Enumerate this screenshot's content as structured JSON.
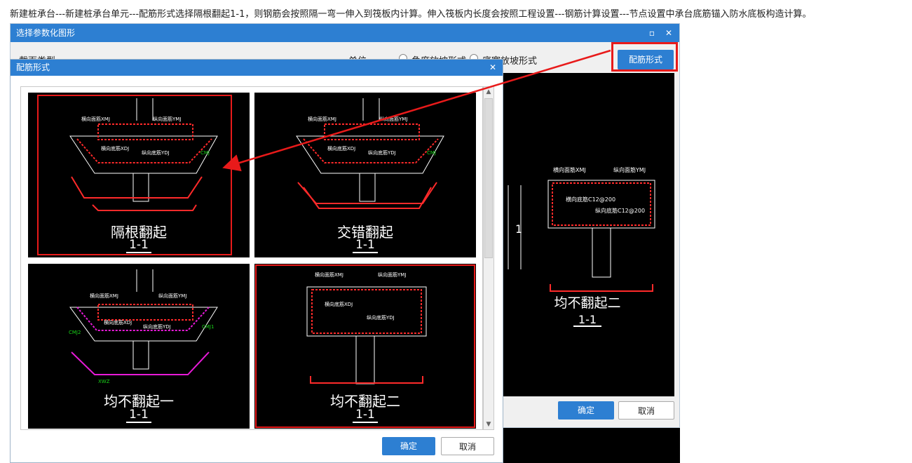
{
  "instruction_text": "新建桩承台---新建桩承台单元---配筋形式选择隔根翻起1-1，则钢筋会按照隔一弯一伸入到筏板内计算。伸入筏板内长度会按照工程设置---钢筋计算设置---节点设置中承台底筋锚入防水底板构造计算。",
  "outer_dialog": {
    "title": "选择参数化图形",
    "row_left_label": "截面类型",
    "row_mid_label": "单位",
    "radio1_label": "角度放坡形式",
    "radio2_label": "底宽放坡形式",
    "peijin_button": "配筋形式",
    "preview": {
      "number_label": "1",
      "top_left_label": "横向面筋XMJ",
      "top_right_label": "纵向面筋YMJ",
      "bottom_left_label": "横向底筋C12@200",
      "bottom_right_label": "纵向底筋C12@200",
      "caption": "均不翻起二",
      "sub": "1-1"
    },
    "ok_button": "确定",
    "cancel_button": "取消"
  },
  "inner_dialog": {
    "title": "配筋形式",
    "close_icon": "close-icon",
    "panels": [
      {
        "caption": "隔根翻起",
        "sub": "1-1",
        "selected": true
      },
      {
        "caption": "交错翻起",
        "sub": "1-1",
        "selected": false
      },
      {
        "caption": "均不翻起一",
        "sub": "1-1",
        "selected": false
      },
      {
        "caption": "均不翻起二",
        "sub": "1-1",
        "selected": true
      }
    ],
    "drawing_labels": {
      "xmj": "横向面筋XMJ",
      "ymj": "纵向面筋YMJ",
      "xdj": "横向底筋XDJ",
      "ydj": "纵向底筋YDJ",
      "cmj": "CMJ",
      "cmj1": "CMJ1",
      "cmj2": "CMJ2",
      "xwz": "XWZ"
    },
    "ok_button": "确定",
    "cancel_button": "取消"
  },
  "colors": {
    "title_bar": "#2d7fd2",
    "highlight": "#e81a1a",
    "rebar_green": "#19d419",
    "rebar_red": "#ff2a2a",
    "rebar_magenta": "#e81ad8"
  }
}
